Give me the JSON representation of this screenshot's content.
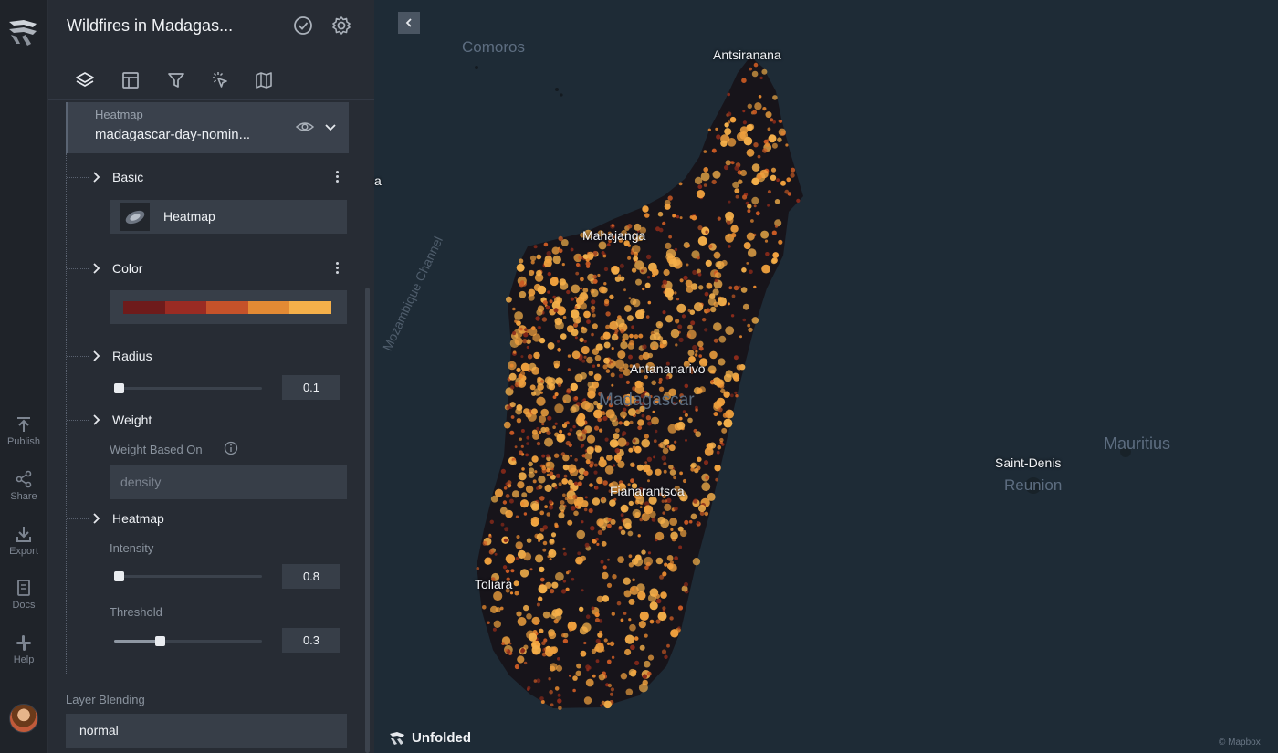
{
  "project": {
    "title": "Wildfires in Madagas...",
    "check_icon": "check-circle-icon",
    "settings_icon": "gear-icon"
  },
  "rail": {
    "items": [
      {
        "label": "Publish",
        "icon": "upload-icon"
      },
      {
        "label": "Share",
        "icon": "share-icon"
      },
      {
        "label": "Export",
        "icon": "download-icon"
      },
      {
        "label": "Docs",
        "icon": "book-icon"
      },
      {
        "label": "Help",
        "icon": "slack-icon"
      }
    ]
  },
  "tabs": [
    "layers-icon",
    "layout-icon",
    "filter-icon",
    "interaction-icon",
    "basemap-icon"
  ],
  "layer": {
    "type": "Heatmap",
    "name": "madagascar-day-nomin..."
  },
  "sections": {
    "basic": {
      "label": "Basic",
      "type_label": "Heatmap"
    },
    "color": {
      "label": "Color",
      "palette": [
        "#6e1b1b",
        "#9a2b23",
        "#c5522a",
        "#e38a34",
        "#f5b04a"
      ]
    },
    "radius": {
      "label": "Radius",
      "value": "0.1",
      "fraction": 0.0
    },
    "weight": {
      "label": "Weight",
      "based_on_label": "Weight Based On",
      "placeholder": "density"
    },
    "heatmap": {
      "label": "Heatmap",
      "intensity_label": "Intensity",
      "intensity_value": "0.8",
      "intensity_fraction": 0.0,
      "threshold_label": "Threshold",
      "threshold_value": "0.3",
      "threshold_fraction": 0.3
    }
  },
  "blending": {
    "label": "Layer Blending",
    "value": "normal"
  },
  "map": {
    "labels": {
      "comoros": "Comoros",
      "antsiranana": "Antsiranana",
      "mahajanga": "Mahajanga",
      "antananarivo": "Antananarivo",
      "madagascar": "Madagascar",
      "fianarantsoa": "Fianarantsoa",
      "toliara": "Toliara",
      "mozambique_channel": "Mozambique Channel",
      "saint_denis": "Saint-Denis",
      "reunion": "Reunion",
      "mauritius": "Mauritius",
      "edge_label": "a"
    },
    "brand": "Unfolded",
    "attribution": "© Mapbox"
  }
}
